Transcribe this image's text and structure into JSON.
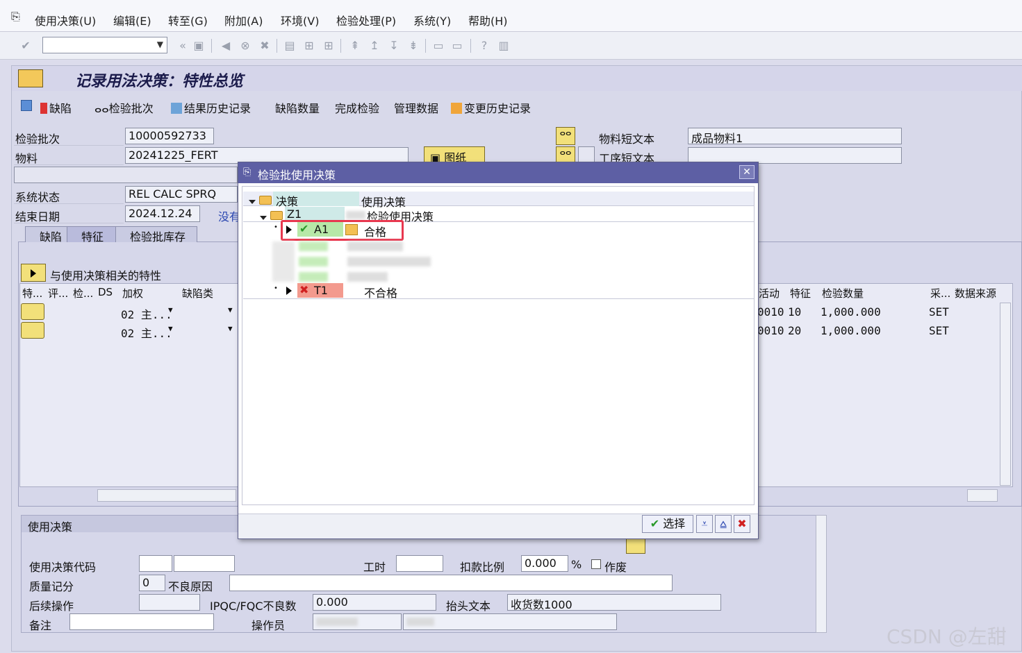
{
  "menu": {
    "items": [
      "使用决策(U)",
      "编辑(E)",
      "转至(G)",
      "附加(A)",
      "环境(V)",
      "检验处理(P)",
      "系统(Y)",
      "帮助(H)"
    ]
  },
  "title": "记录用法决策：特性总览",
  "appbar": {
    "defects": "缺陷",
    "inspection_lot": "检验批次",
    "results_history": "结果历史记录",
    "defect_qty": "缺陷数量",
    "complete_inspection": "完成检验",
    "manage_data": "管理数据",
    "change_history": "变更历史记录"
  },
  "header": {
    "lot_label": "检验批次",
    "lot_value": "10000592733",
    "material_label": "物料",
    "material_value": "20241225_FERT",
    "drawing_btn": "图纸",
    "mat_short_label": "物料短文本",
    "mat_short_value": "成品物料1",
    "op_short_label": "工序短文本",
    "sys_status_label": "系统状态",
    "sys_status_value": "REL   CALC  SPRQ",
    "end_date_label": "结束日期",
    "end_date_value": "2024.12.24",
    "no_text": "没有"
  },
  "tabs": [
    "缺陷",
    "特征",
    "检验批库存"
  ],
  "char_section": {
    "title": "与使用决策相关的特性",
    "left_headers": [
      "特...",
      "评...",
      "检...",
      "DS",
      "加权",
      "缺陷类"
    ],
    "right_headers": [
      "活动",
      "特征",
      "检验数量",
      "采...",
      "数据来源"
    ],
    "rows": [
      {
        "weight": "02 主...",
        "activity": "0010",
        "char": "10",
        "qty": "1,000.000",
        "sample": "SET"
      },
      {
        "weight": "02 主...",
        "activity": "0010",
        "char": "20",
        "qty": "1,000.000",
        "sample": "SET"
      }
    ]
  },
  "ud_section": {
    "title": "使用决策",
    "code_label": "使用决策代码",
    "hours_label": "工时",
    "deduct_label": "扣款比例",
    "deduct_value": "0.000",
    "percent": "%",
    "void_label": "作废",
    "quality_score_label": "质量记分",
    "quality_score_value": "0",
    "bad_reason_label": "不良原因",
    "follow_up_label": "后续操作",
    "ipqc_label": "IPQC/FQC不良数",
    "ipqc_value": "0.000",
    "header_text_label": "抬头文本",
    "header_text_value": "收货数1000",
    "remark_label": "备注",
    "operator_label": "操作员"
  },
  "dialog": {
    "title": "检验批使用决策",
    "col1": "决策",
    "col2": "使用决策",
    "z1_code": "Z1",
    "z1_text": "检验使用决策",
    "a1_code": "A1",
    "a1_text": "合格",
    "t1_code": "T1",
    "t1_text": "不合格",
    "select_btn": "选择"
  },
  "watermark": "CSDN @左甜甜",
  "colors": {
    "highlight_box": "#e8384f",
    "accept_green": "#b7e8a8",
    "reject_red": "#f39a8e",
    "dialog_title": "#5d5fa4"
  }
}
